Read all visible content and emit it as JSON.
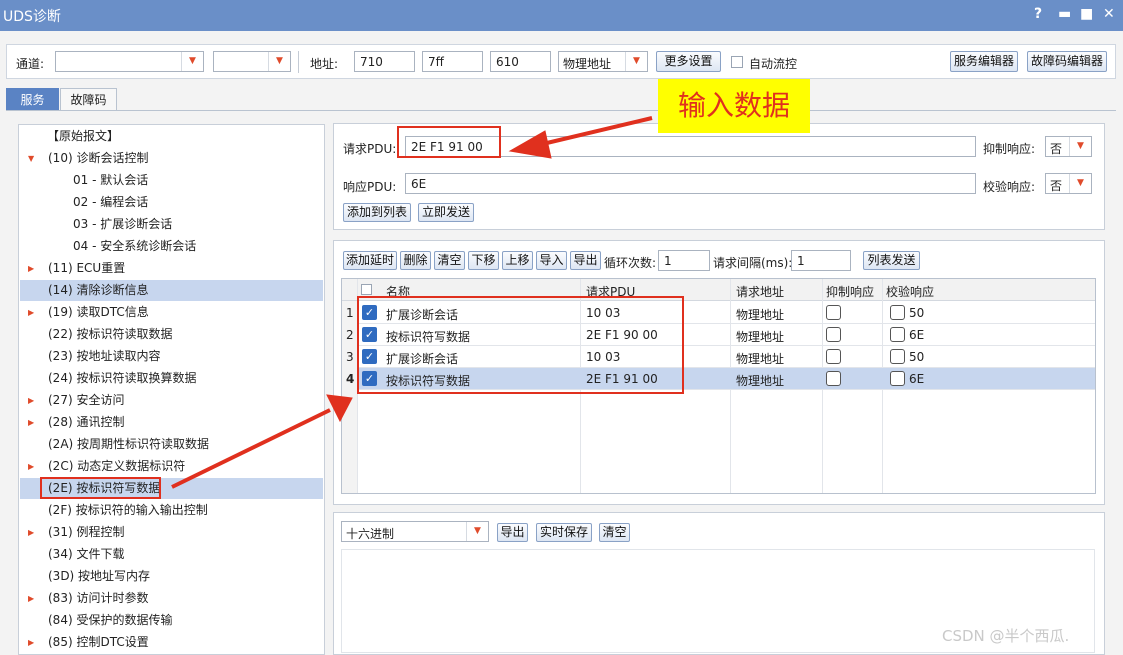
{
  "window": {
    "title": "UDS诊断",
    "controls": [
      "?",
      "▬",
      "■",
      "✕"
    ]
  },
  "toolbar": {
    "channel_label": "通道:",
    "channel_value": "",
    "second_value": "",
    "addr_label": "地址:",
    "addr1": "710",
    "addr2": "7ff",
    "addr3": "610",
    "addr_mode": "物理地址",
    "more_settings": "更多设置",
    "auto_flow": "自动流控",
    "service_editor": "服务编辑器",
    "dtc_editor": "故障码编辑器"
  },
  "tabs": [
    {
      "label": "服务",
      "active": true
    },
    {
      "label": "故障码",
      "active": false
    }
  ],
  "tree": {
    "items": [
      {
        "label": "【原始报文】",
        "expanded": null,
        "selected": false
      },
      {
        "label": "(10) 诊断会话控制",
        "expanded": true,
        "selected": false
      },
      {
        "label": "01 - 默认会话",
        "expanded": null,
        "selected": false
      },
      {
        "label": "02 - 编程会话",
        "expanded": null,
        "selected": false
      },
      {
        "label": "03 - 扩展诊断会话",
        "expanded": null,
        "selected": false
      },
      {
        "label": "04 - 安全系统诊断会话",
        "expanded": null,
        "selected": false
      },
      {
        "label": "(11) ECU重置",
        "expanded": false,
        "selected": false
      },
      {
        "label": "(14) 清除诊断信息",
        "expanded": null,
        "selected": true
      },
      {
        "label": "(19) 读取DTC信息",
        "expanded": false,
        "selected": false
      },
      {
        "label": "(22) 按标识符读取数据",
        "expanded": null,
        "selected": false
      },
      {
        "label": "(23) 按地址读取内容",
        "expanded": null,
        "selected": false
      },
      {
        "label": "(24) 按标识符读取换算数据",
        "expanded": null,
        "selected": false
      },
      {
        "label": "(27) 安全访问",
        "expanded": false,
        "selected": false
      },
      {
        "label": "(28) 通讯控制",
        "expanded": false,
        "selected": false
      },
      {
        "label": "(2A) 按周期性标识符读取数据",
        "expanded": null,
        "selected": false
      },
      {
        "label": "(2C) 动态定义数据标识符",
        "expanded": false,
        "selected": false
      },
      {
        "label": "(2E) 按标识符写数据",
        "expanded": null,
        "selected": true
      },
      {
        "label": "(2F) 按标识符的输入输出控制",
        "expanded": null,
        "selected": false
      },
      {
        "label": "(31) 例程控制",
        "expanded": false,
        "selected": false
      },
      {
        "label": "(34) 文件下载",
        "expanded": null,
        "selected": false
      },
      {
        "label": "(3D) 按地址写内存",
        "expanded": null,
        "selected": false
      },
      {
        "label": "(83) 访问计时参数",
        "expanded": false,
        "selected": false
      },
      {
        "label": "(84) 受保护的数据传输",
        "expanded": null,
        "selected": false
      },
      {
        "label": "(85) 控制DTC设置",
        "expanded": false,
        "selected": false
      }
    ]
  },
  "request": {
    "req_label": "请求PDU:",
    "req_value": "2E F1 91 00",
    "resp_label": "响应PDU:",
    "resp_value": "6E",
    "suppress_label": "抑制响应:",
    "suppress_value": "否",
    "verify_label": "校验响应:",
    "verify_value": "否",
    "add_btn": "添加到列表",
    "send_btn": "立即发送"
  },
  "list_toolbar": {
    "add_delay": "添加延时",
    "delete": "删除",
    "clear": "清空",
    "down": "下移",
    "up": "上移",
    "import": "导入",
    "export": "导出",
    "loop_label": "循环次数:",
    "loop_value": "1",
    "interval_label": "请求间隔(ms):",
    "interval_value": "1",
    "list_send": "列表发送"
  },
  "table": {
    "headers": [
      "名称",
      "请求PDU",
      "请求地址",
      "抑制响应",
      "校验响应"
    ],
    "rows": [
      {
        "num": "1",
        "checked": true,
        "name": "扩展诊断会话",
        "pdu": "10 03",
        "addr": "物理地址",
        "suppress": false,
        "verify": "50",
        "selected": false
      },
      {
        "num": "2",
        "checked": true,
        "name": "按标识符写数据",
        "pdu": "2E F1 90 00",
        "addr": "物理地址",
        "suppress": false,
        "verify": "6E",
        "selected": false
      },
      {
        "num": "3",
        "checked": true,
        "name": "扩展诊断会话",
        "pdu": "10 03",
        "addr": "物理地址",
        "suppress": false,
        "verify": "50",
        "selected": false
      },
      {
        "num": "4",
        "checked": true,
        "name": "按标识符写数据",
        "pdu": "2E F1 91 00",
        "addr": "物理地址",
        "suppress": false,
        "verify": "6E",
        "selected": true
      }
    ]
  },
  "output": {
    "format": "十六进制",
    "export": "导出",
    "realtime_save": "实时保存",
    "clear": "清空"
  },
  "annotation": {
    "text": "输入数据",
    "color": "#e0301e",
    "bg": "#ffff00"
  },
  "watermark": "CSDN @半个西瓜."
}
